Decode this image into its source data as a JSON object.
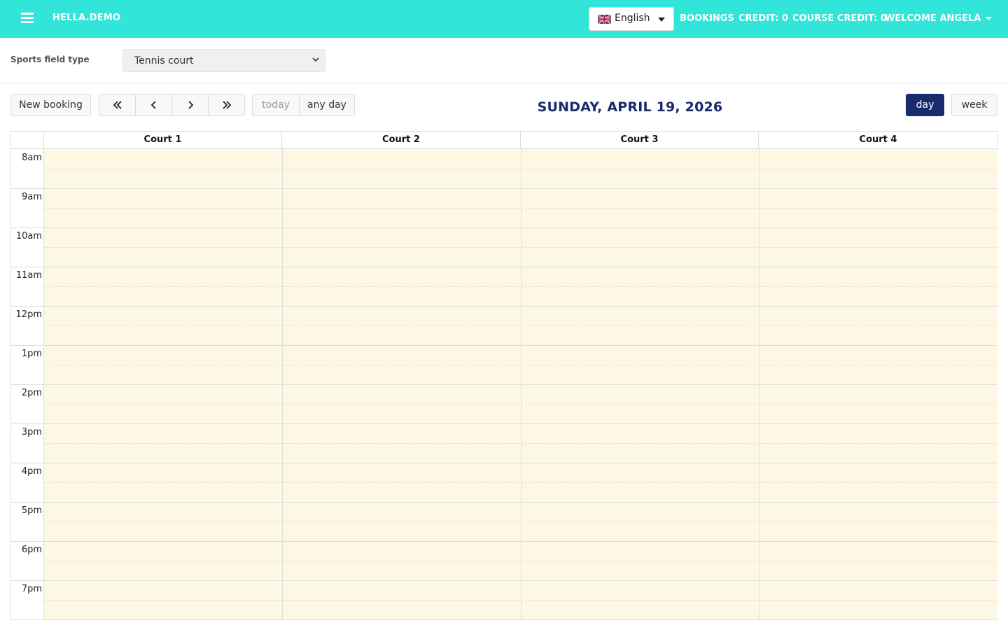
{
  "topbar": {
    "brand": "HELLA.DEMO",
    "language": "English",
    "links": {
      "bookings": "BOOKINGS",
      "credit": "CREDIT: 0",
      "course_credit": "COURSE CREDIT: 0",
      "welcome": "WELCOME ANGELA"
    }
  },
  "filter": {
    "label": "Sports field type",
    "selected": "Tennis court"
  },
  "toolbar": {
    "new_booking": "New booking",
    "today": "today",
    "any_day": "any day",
    "day": "day",
    "week": "week",
    "date_title": "SUNDAY, APRIL 19, 2026"
  },
  "calendar": {
    "courts": [
      "Court 1",
      "Court 2",
      "Court 3",
      "Court 4"
    ],
    "times": [
      "8am",
      "9am",
      "10am",
      "11am",
      "12pm",
      "1pm",
      "2pm",
      "3pm",
      "4pm",
      "5pm",
      "6pm",
      "7pm"
    ],
    "colors": {
      "slot_bg": "#fcf8e3",
      "grid_line": "#dddddd",
      "accent": "#1a2b6d",
      "topbar": "#31e5d9"
    }
  }
}
